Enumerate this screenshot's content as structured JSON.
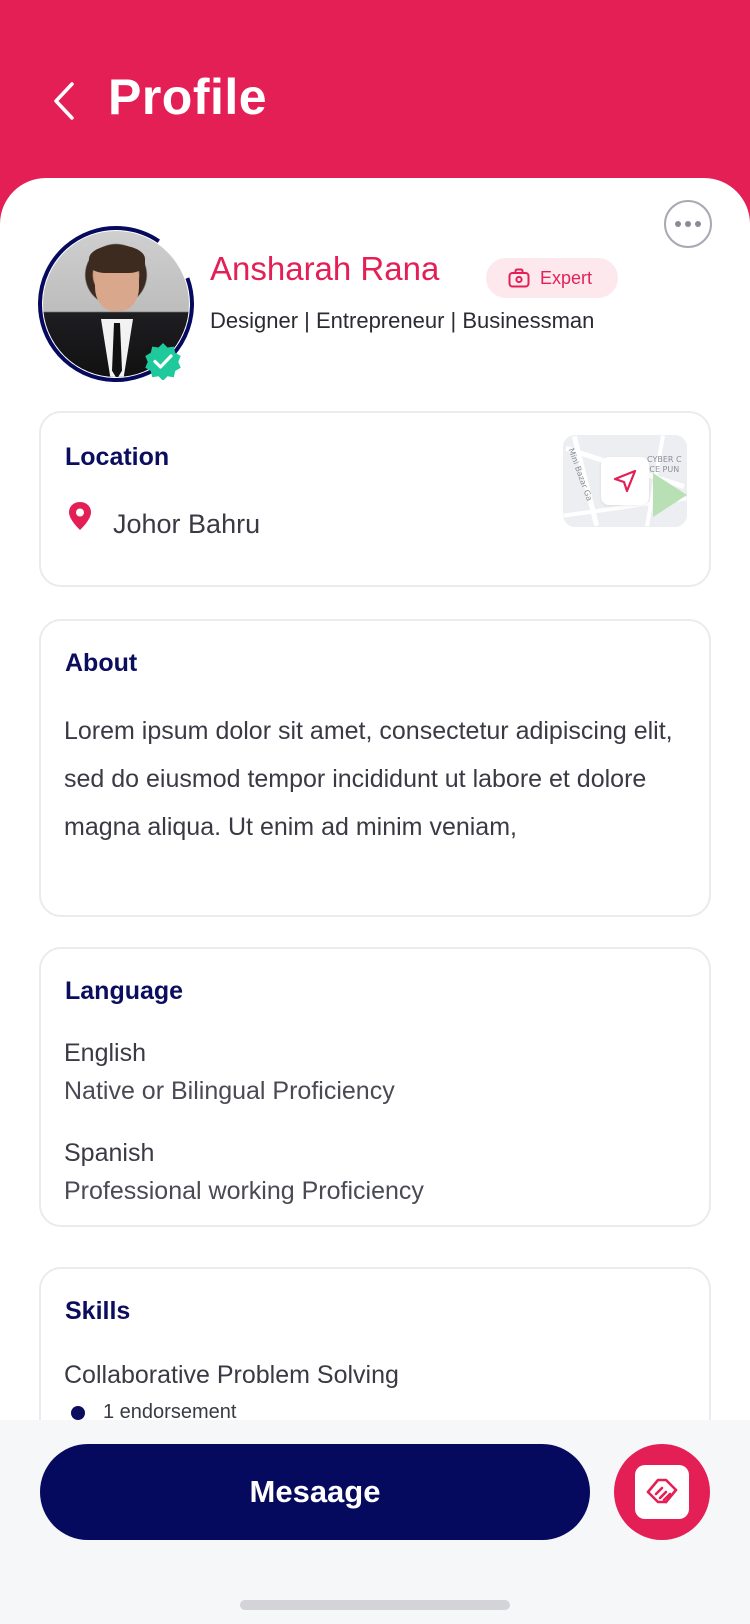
{
  "header": {
    "title": "Profile"
  },
  "profile": {
    "name": "Ansharah Rana",
    "badge": "Expert",
    "tagline": "Designer |  Entrepreneur | Businessman"
  },
  "location": {
    "title": "Location",
    "city": "Johor Bahru",
    "map_labels": [
      "CYBER C",
      "ICE PUN",
      "Mini Bazar Ga"
    ]
  },
  "about": {
    "title": "About",
    "text": "Lorem ipsum dolor sit amet, consectetur adipiscing elit, sed do eiusmod tempor incididunt ut labore et dolore magna aliqua. Ut enim ad minim veniam,"
  },
  "language": {
    "title": "Language",
    "items": [
      {
        "name": "English",
        "level": "Native or  Bilingual Proficiency"
      },
      {
        "name": "Spanish",
        "level": "Professional working Proficiency"
      }
    ]
  },
  "skills": {
    "title": "Skills",
    "items": [
      {
        "name": "Collaborative Problem Solving",
        "endorsements": "1 endorsement"
      }
    ]
  },
  "actions": {
    "message_label": "Mesaage"
  },
  "colors": {
    "brand": "#e41f56",
    "navy": "#060a5e",
    "verified": "#1ec99b"
  },
  "icons": {
    "back": "chevron-left-icon",
    "more": "more-horizontal-icon",
    "verified": "verified-badge-icon",
    "expert": "briefcase-icon",
    "pin": "location-pin-icon",
    "navigate": "navigation-arrow-icon",
    "handshake": "handshake-icon"
  }
}
